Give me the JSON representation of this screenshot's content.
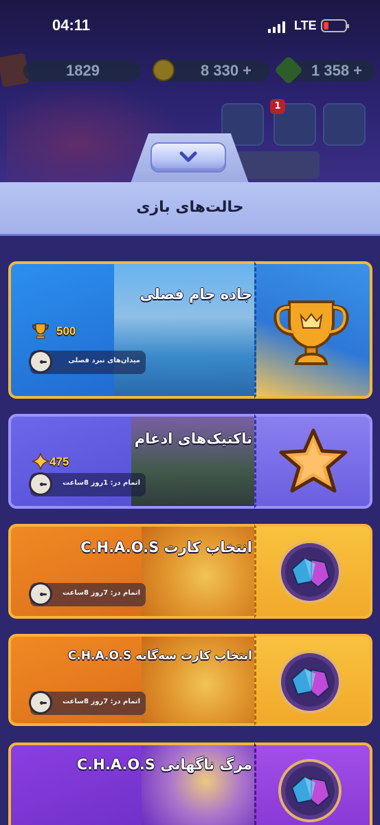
{
  "status_bar": {
    "time": "04:11",
    "network": "LTE"
  },
  "hub": {
    "trophies": "1829",
    "coins": "8 330",
    "gems": "1 358",
    "notification_count": "1"
  },
  "panel": {
    "title": "حالت‌های بازی"
  },
  "modes": [
    {
      "title": "جاده جام فصلی",
      "reward": "500",
      "reward_icon": "trophy-icon",
      "info": "میدان‌های نبرد فصلی",
      "stub_icon": "big-trophy-icon",
      "colors": {
        "main": "#2f79dc",
        "border": "#f2b93a",
        "stub": "#3f86e0"
      }
    },
    {
      "title": "تاکتیک‌های ادغام",
      "reward": "475",
      "reward_icon": "sparkle-icon",
      "info": "اتمام در: 1روز 8ساعت",
      "stub_icon": "star-icon",
      "colors": {
        "main": "#5b57dd",
        "border": "#9a93ff",
        "stub": "#7b70ea"
      }
    },
    {
      "title": "انتخاب کارت C.H.A.O.S",
      "info": "اتمام در: 7روز 8ساعت",
      "stub_icon": "rune-icon",
      "colors": {
        "main": "#e8821f",
        "border": "#f5b63a",
        "stub": "#f6b93a"
      }
    },
    {
      "title": "انتخاب کارت سه‌گانه C.H.A.O.S",
      "info": "اتمام در: 7روز 8ساعت",
      "stub_icon": "rune-icon",
      "colors": {
        "main": "#e8821f",
        "border": "#f5b63a",
        "stub": "#f6b93a"
      }
    },
    {
      "title": "مرگ ناگهانی C.H.A.O.S",
      "stub_icon": "rune-icon",
      "colors": {
        "main": "#7d35cf",
        "border": "#f5b63a",
        "stub": "#9b48e6"
      }
    }
  ]
}
